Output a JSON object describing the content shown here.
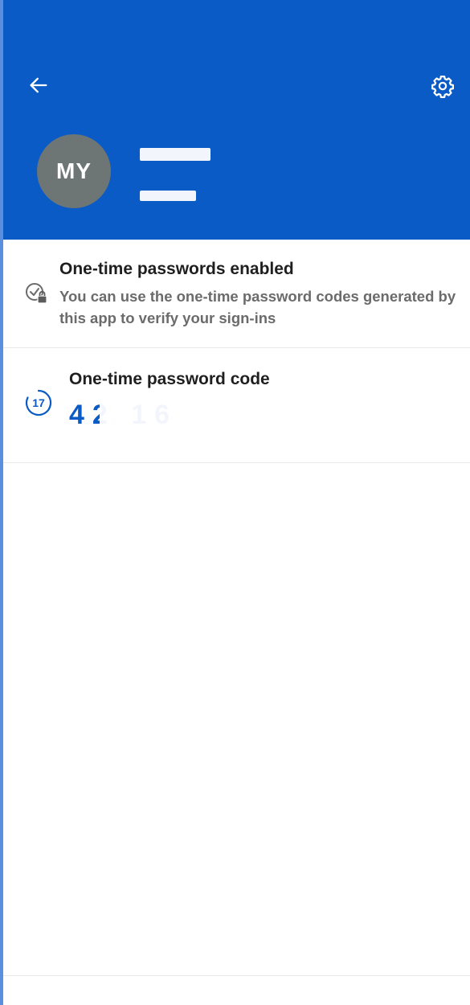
{
  "header": {
    "background_color": "#0a5bc6",
    "back_icon": "arrow-left-icon",
    "settings_icon": "gear-icon",
    "avatar_initials": "MY",
    "avatar_color": "#6d7675",
    "account_name": "",
    "account_username": ""
  },
  "status": {
    "icon": "check-lock-icon",
    "title": "One-time passwords enabled",
    "description": "You can use the one-time password codes generated by this app to verify your sign-ins"
  },
  "otp": {
    "icon": "countdown-timer-icon",
    "seconds_remaining": "17",
    "title": "One-time password code",
    "code": "42  16",
    "code_color": "#0a5bc6"
  }
}
